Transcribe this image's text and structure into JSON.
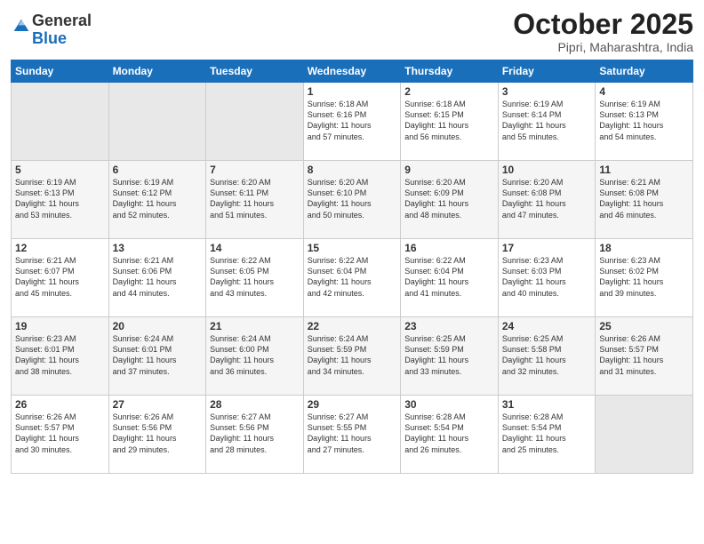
{
  "header": {
    "logo_line1": "General",
    "logo_line2": "Blue",
    "month": "October 2025",
    "location": "Pipri, Maharashtra, India"
  },
  "days_of_week": [
    "Sunday",
    "Monday",
    "Tuesday",
    "Wednesday",
    "Thursday",
    "Friday",
    "Saturday"
  ],
  "weeks": [
    [
      {
        "day": "",
        "info": ""
      },
      {
        "day": "",
        "info": ""
      },
      {
        "day": "",
        "info": ""
      },
      {
        "day": "1",
        "info": "Sunrise: 6:18 AM\nSunset: 6:16 PM\nDaylight: 11 hours\nand 57 minutes."
      },
      {
        "day": "2",
        "info": "Sunrise: 6:18 AM\nSunset: 6:15 PM\nDaylight: 11 hours\nand 56 minutes."
      },
      {
        "day": "3",
        "info": "Sunrise: 6:19 AM\nSunset: 6:14 PM\nDaylight: 11 hours\nand 55 minutes."
      },
      {
        "day": "4",
        "info": "Sunrise: 6:19 AM\nSunset: 6:13 PM\nDaylight: 11 hours\nand 54 minutes."
      }
    ],
    [
      {
        "day": "5",
        "info": "Sunrise: 6:19 AM\nSunset: 6:13 PM\nDaylight: 11 hours\nand 53 minutes."
      },
      {
        "day": "6",
        "info": "Sunrise: 6:19 AM\nSunset: 6:12 PM\nDaylight: 11 hours\nand 52 minutes."
      },
      {
        "day": "7",
        "info": "Sunrise: 6:20 AM\nSunset: 6:11 PM\nDaylight: 11 hours\nand 51 minutes."
      },
      {
        "day": "8",
        "info": "Sunrise: 6:20 AM\nSunset: 6:10 PM\nDaylight: 11 hours\nand 50 minutes."
      },
      {
        "day": "9",
        "info": "Sunrise: 6:20 AM\nSunset: 6:09 PM\nDaylight: 11 hours\nand 48 minutes."
      },
      {
        "day": "10",
        "info": "Sunrise: 6:20 AM\nSunset: 6:08 PM\nDaylight: 11 hours\nand 47 minutes."
      },
      {
        "day": "11",
        "info": "Sunrise: 6:21 AM\nSunset: 6:08 PM\nDaylight: 11 hours\nand 46 minutes."
      }
    ],
    [
      {
        "day": "12",
        "info": "Sunrise: 6:21 AM\nSunset: 6:07 PM\nDaylight: 11 hours\nand 45 minutes."
      },
      {
        "day": "13",
        "info": "Sunrise: 6:21 AM\nSunset: 6:06 PM\nDaylight: 11 hours\nand 44 minutes."
      },
      {
        "day": "14",
        "info": "Sunrise: 6:22 AM\nSunset: 6:05 PM\nDaylight: 11 hours\nand 43 minutes."
      },
      {
        "day": "15",
        "info": "Sunrise: 6:22 AM\nSunset: 6:04 PM\nDaylight: 11 hours\nand 42 minutes."
      },
      {
        "day": "16",
        "info": "Sunrise: 6:22 AM\nSunset: 6:04 PM\nDaylight: 11 hours\nand 41 minutes."
      },
      {
        "day": "17",
        "info": "Sunrise: 6:23 AM\nSunset: 6:03 PM\nDaylight: 11 hours\nand 40 minutes."
      },
      {
        "day": "18",
        "info": "Sunrise: 6:23 AM\nSunset: 6:02 PM\nDaylight: 11 hours\nand 39 minutes."
      }
    ],
    [
      {
        "day": "19",
        "info": "Sunrise: 6:23 AM\nSunset: 6:01 PM\nDaylight: 11 hours\nand 38 minutes."
      },
      {
        "day": "20",
        "info": "Sunrise: 6:24 AM\nSunset: 6:01 PM\nDaylight: 11 hours\nand 37 minutes."
      },
      {
        "day": "21",
        "info": "Sunrise: 6:24 AM\nSunset: 6:00 PM\nDaylight: 11 hours\nand 36 minutes."
      },
      {
        "day": "22",
        "info": "Sunrise: 6:24 AM\nSunset: 5:59 PM\nDaylight: 11 hours\nand 34 minutes."
      },
      {
        "day": "23",
        "info": "Sunrise: 6:25 AM\nSunset: 5:59 PM\nDaylight: 11 hours\nand 33 minutes."
      },
      {
        "day": "24",
        "info": "Sunrise: 6:25 AM\nSunset: 5:58 PM\nDaylight: 11 hours\nand 32 minutes."
      },
      {
        "day": "25",
        "info": "Sunrise: 6:26 AM\nSunset: 5:57 PM\nDaylight: 11 hours\nand 31 minutes."
      }
    ],
    [
      {
        "day": "26",
        "info": "Sunrise: 6:26 AM\nSunset: 5:57 PM\nDaylight: 11 hours\nand 30 minutes."
      },
      {
        "day": "27",
        "info": "Sunrise: 6:26 AM\nSunset: 5:56 PM\nDaylight: 11 hours\nand 29 minutes."
      },
      {
        "day": "28",
        "info": "Sunrise: 6:27 AM\nSunset: 5:56 PM\nDaylight: 11 hours\nand 28 minutes."
      },
      {
        "day": "29",
        "info": "Sunrise: 6:27 AM\nSunset: 5:55 PM\nDaylight: 11 hours\nand 27 minutes."
      },
      {
        "day": "30",
        "info": "Sunrise: 6:28 AM\nSunset: 5:54 PM\nDaylight: 11 hours\nand 26 minutes."
      },
      {
        "day": "31",
        "info": "Sunrise: 6:28 AM\nSunset: 5:54 PM\nDaylight: 11 hours\nand 25 minutes."
      },
      {
        "day": "",
        "info": ""
      }
    ]
  ]
}
